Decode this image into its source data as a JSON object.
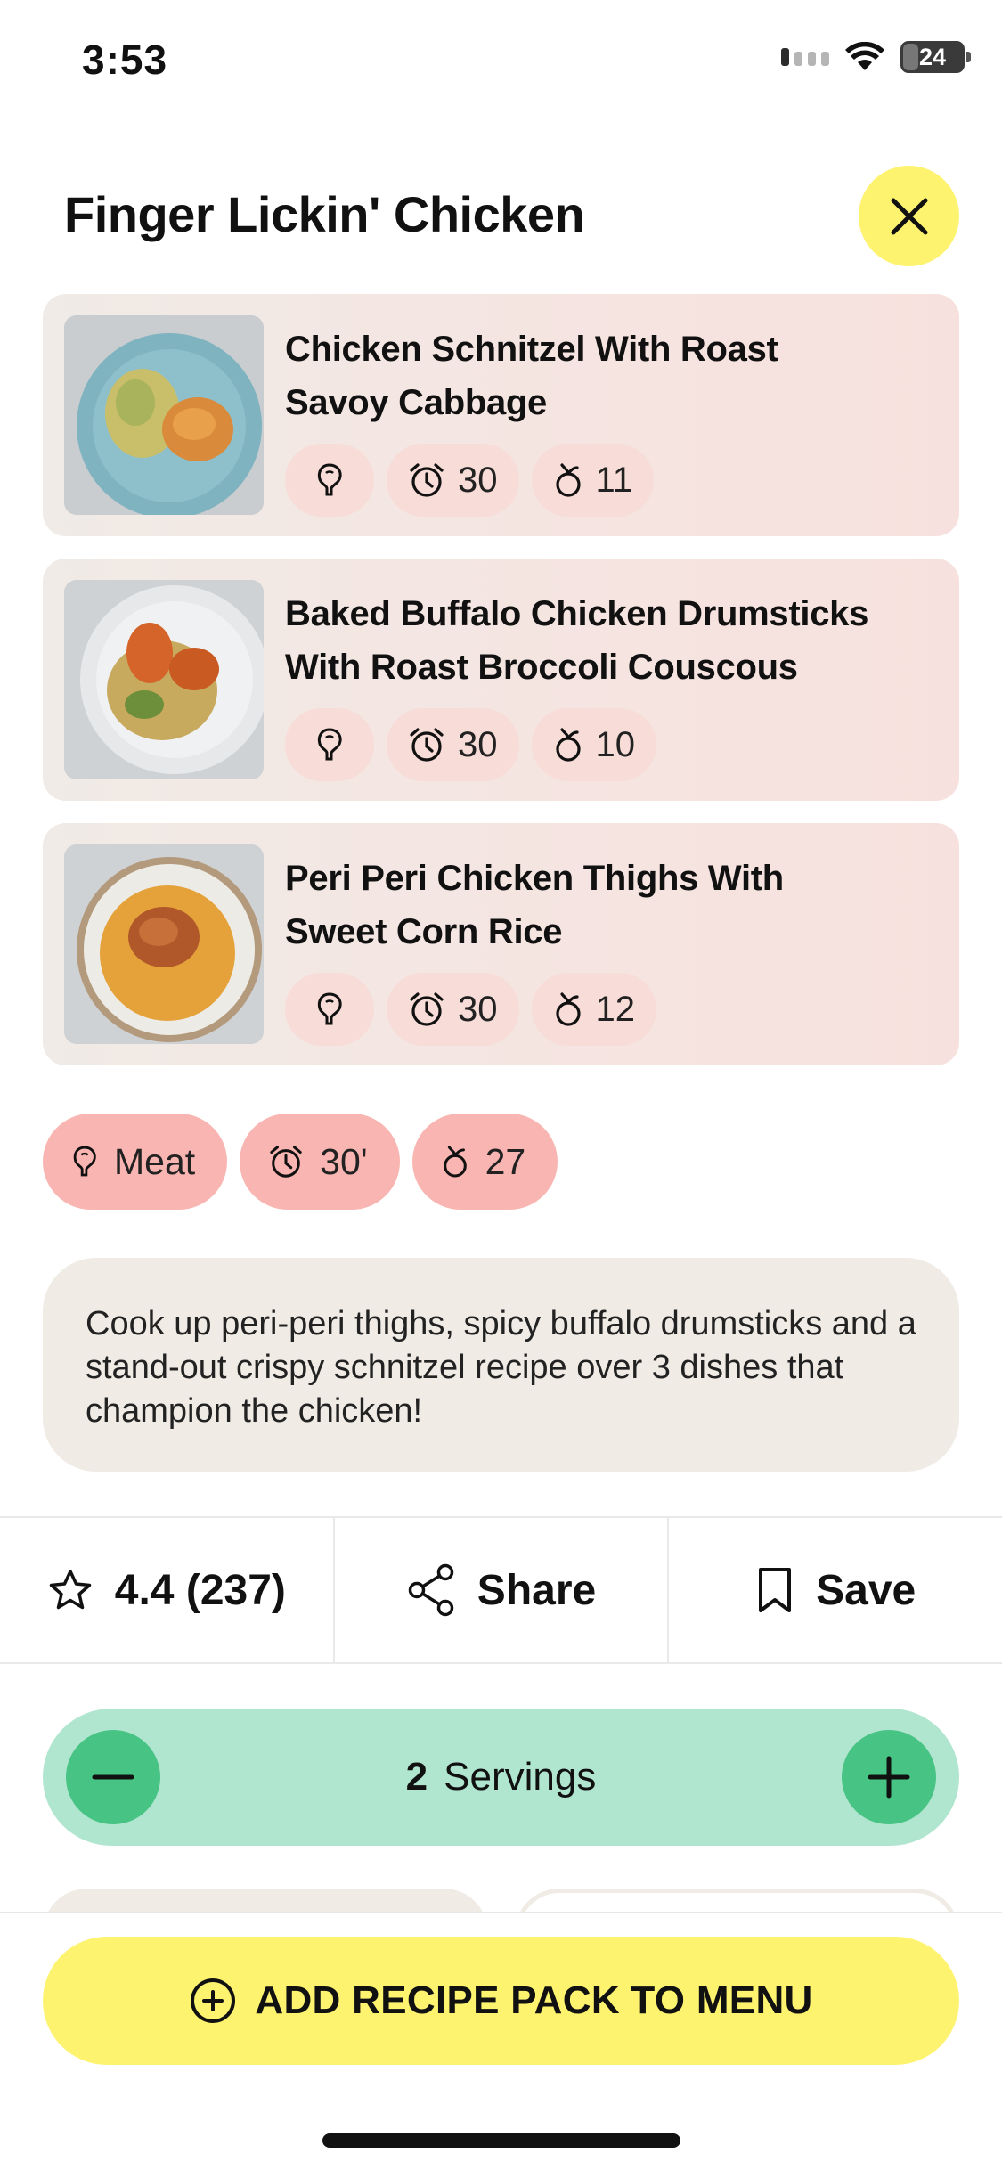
{
  "status_bar": {
    "time": "3:53",
    "battery": "24"
  },
  "header": {
    "title": "Finger Lickin' Chicken"
  },
  "recipes": [
    {
      "title": "Chicken Schnitzel With Roast Savoy Cabbage",
      "time": "30",
      "ingredients": "11",
      "plate": "#7fb3c0",
      "food": "#c9bf6a"
    },
    {
      "title": "Baked Buffalo Chicken Drumsticks With Roast Broccoli Couscous",
      "time": "30",
      "ingredients": "10",
      "plate": "#e6e8ea",
      "food": "#c8aa5f"
    },
    {
      "title": "Peri Peri Chicken Thighs With Sweet Corn Rice",
      "time": "30",
      "ingredients": "12",
      "plate": "#ecebe6",
      "food": "#e6a23a"
    }
  ],
  "summary": {
    "diet": "Meat",
    "time": "30'",
    "ingredients": "27"
  },
  "description": "Cook up peri-peri thighs, spicy buffalo drumsticks and a stand-out crispy schnitzel recipe over 3 dishes that champion the chicken!",
  "actions": {
    "rating": "4.4 (237)",
    "share": "Share",
    "save": "Save"
  },
  "servings": {
    "count": "2",
    "label": "Servings"
  },
  "cta": {
    "label": "ADD RECIPE PACK TO MENU"
  },
  "icons": {
    "diet": "drumstick-icon",
    "time": "alarm-clock-icon",
    "ingredients": "ingredient-count-icon",
    "rating": "star-icon",
    "share": "share-icon",
    "save": "bookmark-icon"
  },
  "colors": {
    "accent_yellow": "#fdf36f",
    "card_pink": "#f7e1de",
    "pill_pink": "#f8b5b1",
    "servings_green": "#b0e5cf",
    "button_green": "#47c383"
  }
}
